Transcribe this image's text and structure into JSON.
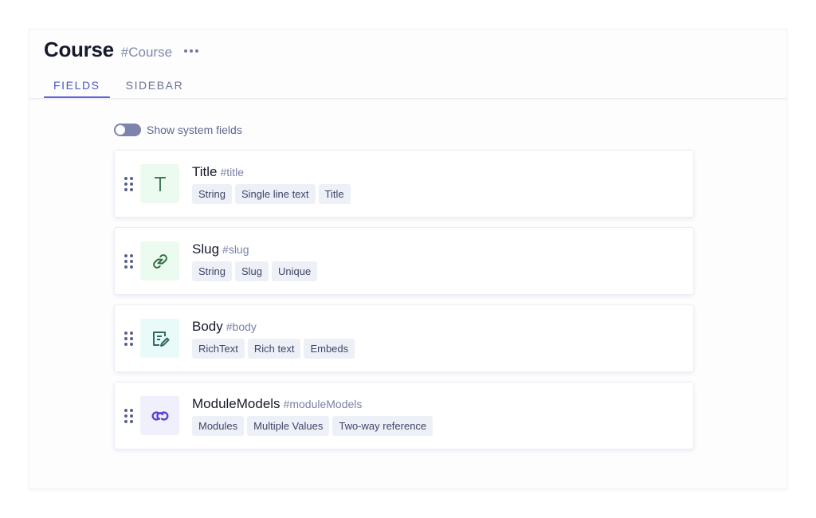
{
  "header": {
    "title": "Course",
    "api_id": "#Course",
    "more_icon": "more-horizontal-icon"
  },
  "tabs": [
    {
      "label": "FIELDS",
      "active": true
    },
    {
      "label": "SIDEBAR",
      "active": false
    }
  ],
  "system_fields_toggle": {
    "label": "Show system fields",
    "enabled": false
  },
  "colors": {
    "accent": "#5b63d6",
    "string_icon_bg": "#ecfbef",
    "string_icon_fg": "#2f6b45",
    "richtext_icon_bg": "#e9fbf8",
    "richtext_icon_fg": "#2e6b68",
    "reference_icon_bg": "#f0f0fd",
    "reference_icon_fg": "#5a3fd6"
  },
  "fields": [
    {
      "name": "Title",
      "api_id": "#title",
      "icon": "text-t-icon",
      "tags": [
        "String",
        "Single line text",
        "Title"
      ]
    },
    {
      "name": "Slug",
      "api_id": "#slug",
      "icon": "link-icon",
      "tags": [
        "String",
        "Slug",
        "Unique"
      ]
    },
    {
      "name": "Body",
      "api_id": "#body",
      "icon": "rich-text-edit-icon",
      "tags": [
        "RichText",
        "Rich text",
        "Embeds"
      ]
    },
    {
      "name": "ModuleModels",
      "api_id": "#moduleModels",
      "icon": "two-way-reference-icon",
      "tags": [
        "Modules",
        "Multiple Values",
        "Two-way reference"
      ]
    }
  ]
}
